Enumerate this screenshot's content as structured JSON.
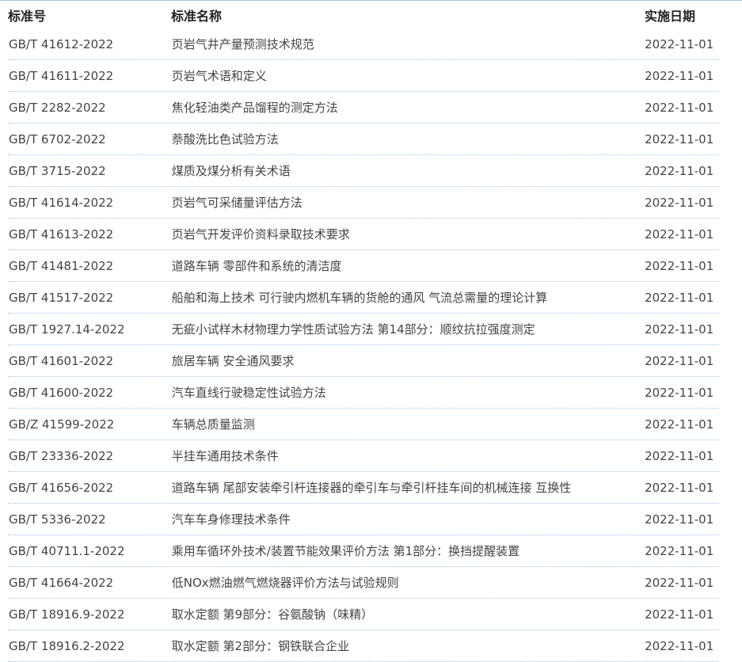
{
  "table": {
    "headers": {
      "code": "标准号",
      "name": "标准名称",
      "date": "实施日期"
    },
    "rows": [
      {
        "code": "GB/T 41612-2022",
        "name": "页岩气井产量预测技术规范",
        "date": "2022-11-01"
      },
      {
        "code": "GB/T 41611-2022",
        "name": "页岩气术语和定义",
        "date": "2022-11-01"
      },
      {
        "code": "GB/T 2282-2022",
        "name": "焦化轻油类产品馏程的测定方法",
        "date": "2022-11-01"
      },
      {
        "code": "GB/T 6702-2022",
        "name": "萘酸洗比色试验方法",
        "date": "2022-11-01"
      },
      {
        "code": "GB/T 3715-2022",
        "name": "煤质及煤分析有关术语",
        "date": "2022-11-01"
      },
      {
        "code": "GB/T 41614-2022",
        "name": "页岩气可采储量评估方法",
        "date": "2022-11-01"
      },
      {
        "code": "GB/T 41613-2022",
        "name": "页岩气开发评价资料录取技术要求",
        "date": "2022-11-01"
      },
      {
        "code": "GB/T 41481-2022",
        "name": "道路车辆 零部件和系统的清洁度",
        "date": "2022-11-01"
      },
      {
        "code": "GB/T 41517-2022",
        "name": "船舶和海上技术 可行驶内燃机车辆的货舱的通风 气流总需量的理论计算",
        "date": "2022-11-01"
      },
      {
        "code": "GB/T 1927.14-2022",
        "name": "无疵小试样木材物理力学性质试验方法 第14部分：顺纹抗拉强度测定",
        "date": "2022-11-01"
      },
      {
        "code": "GB/T 41601-2022",
        "name": "旅居车辆 安全通风要求",
        "date": "2022-11-01"
      },
      {
        "code": "GB/T 41600-2022",
        "name": "汽车直线行驶稳定性试验方法",
        "date": "2022-11-01"
      },
      {
        "code": "GB/Z 41599-2022",
        "name": "车辆总质量监测",
        "date": "2022-11-01"
      },
      {
        "code": "GB/T 23336-2022",
        "name": "半挂车通用技术条件",
        "date": "2022-11-01"
      },
      {
        "code": "GB/T 41656-2022",
        "name": "道路车辆 尾部安装牵引杆连接器的牵引车与牵引杆挂车间的机械连接 互换性",
        "date": "2022-11-01"
      },
      {
        "code": "GB/T 5336-2022",
        "name": "汽车车身修理技术条件",
        "date": "2022-11-01"
      },
      {
        "code": "GB/T 40711.1-2022",
        "name": "乘用车循环外技术/装置节能效果评价方法 第1部分：换挡提醒装置",
        "date": "2022-11-01"
      },
      {
        "code": "GB/T 41664-2022",
        "name": "低NOx燃油燃气燃烧器评价方法与试验规则",
        "date": "2022-11-01"
      },
      {
        "code": "GB/T 18916.9-2022",
        "name": "取水定额 第9部分：谷氨酸钠（味精）",
        "date": "2022-11-01"
      },
      {
        "code": "GB/T 18916.2-2022",
        "name": "取水定额 第2部分：钢铁联合企业",
        "date": "2022-11-01"
      }
    ]
  }
}
